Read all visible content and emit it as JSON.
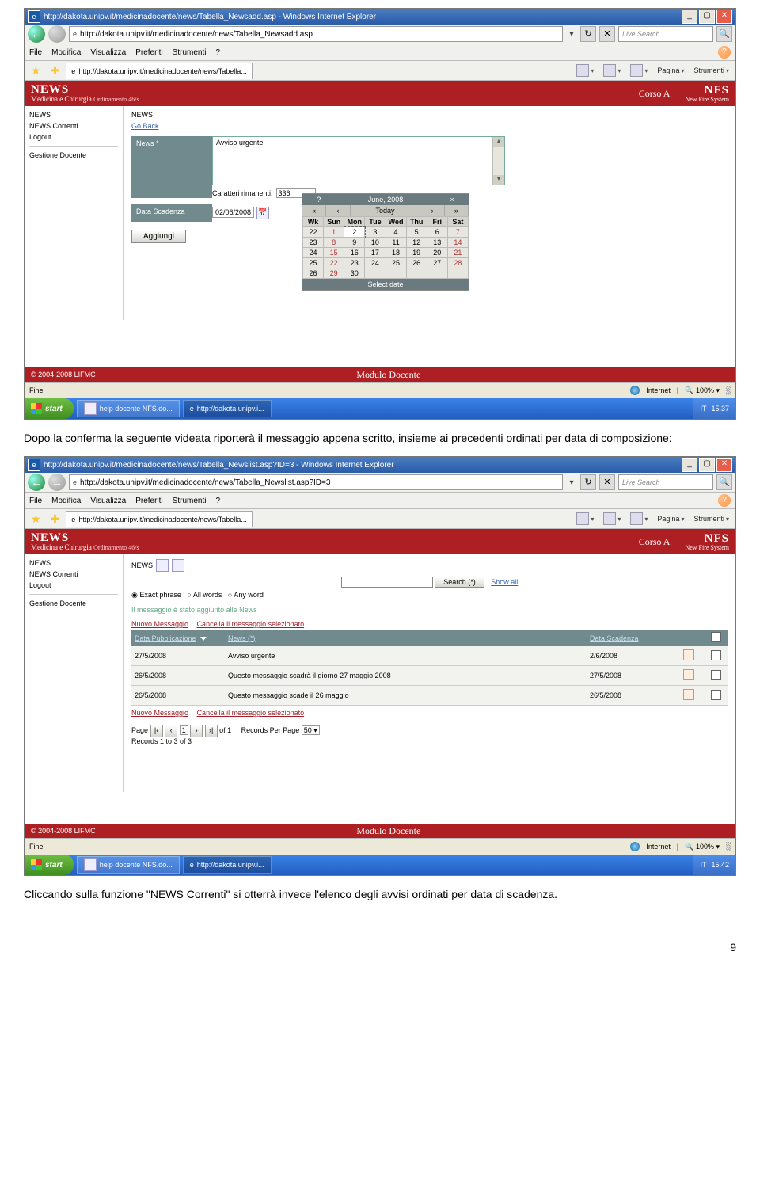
{
  "para1": "Dopo la conferma la seguente videata riporterà il messaggio appena scritto, insieme ai precedenti ordinati per data di composizione:",
  "para2": "Cliccando sulla funzione \"NEWS Correnti\" si otterrà invece l'elenco degli avvisi ordinati per data di scadenza.",
  "page_num": "9",
  "shot1": {
    "title": "http://dakota.unipv.it/medicinadocente/news/Tabella_Newsadd.asp - Windows Internet Explorer",
    "addr": "http://dakota.unipv.it/medicinadocente/news/Tabella_Newsadd.asp",
    "search_ph": "Live Search",
    "menu": [
      "File",
      "Modifica",
      "Visualizza",
      "Preferiti",
      "Strumenti",
      "?"
    ],
    "tab": "http://dakota.unipv.it/medicinadocente/news/Tabella...",
    "tools": {
      "pagina": "Pagina",
      "strumenti": "Strumenti"
    },
    "sidebar": {
      "news": "NEWS",
      "newscorr": "NEWS Correnti",
      "logout": "Logout",
      "gest": "Gestione Docente"
    },
    "hdr": {
      "news": "NEWS",
      "sub": "Medicina e Chirurgia",
      "ord": "Ordinamento 46/s",
      "corso": "Corso A",
      "nfs": "NFS",
      "nfs_sub": "New Fire System"
    },
    "content": {
      "lbl_news": "NEWS",
      "goback": "Go Back",
      "lbl_news2": "News",
      "txt": "Avviso urgente",
      "remain_lbl": "Caratteri rimanenti:",
      "remain_val": "336",
      "lbl_date": "Data Scadenza",
      "date_val": "02/06/2008",
      "btn": "Aggiungi"
    },
    "cal": {
      "month": "June, 2008",
      "today": "Today",
      "hdr2_l": "«",
      "hdr2_l2": "‹",
      "hdr2_r2": "›",
      "hdr2_r": "»",
      "wk": "Wk",
      "days": [
        "Sun",
        "Mon",
        "Tue",
        "Wed",
        "Thu",
        "Fri",
        "Sat"
      ],
      "rows": [
        {
          "wk": "22",
          "d": [
            "1",
            "2",
            "3",
            "4",
            "5",
            "6",
            "7"
          ]
        },
        {
          "wk": "23",
          "d": [
            "8",
            "9",
            "10",
            "11",
            "12",
            "13",
            "14"
          ]
        },
        {
          "wk": "24",
          "d": [
            "15",
            "16",
            "17",
            "18",
            "19",
            "20",
            "21"
          ]
        },
        {
          "wk": "25",
          "d": [
            "22",
            "23",
            "24",
            "25",
            "26",
            "27",
            "28"
          ]
        },
        {
          "wk": "26",
          "d": [
            "29",
            "30",
            "",
            "",
            "",
            "",
            ""
          ]
        }
      ],
      "foot": "Select date"
    },
    "footer": {
      "copy": "© 2004-2008 LIFMC",
      "modulo": "Modulo Docente"
    },
    "status": {
      "fine": "Fine",
      "internet": "Internet",
      "zoom": "100%"
    },
    "taskbar": {
      "start": "start",
      "t1": "help docente NFS.do...",
      "t2": "http://dakota.unipv.i...",
      "clock": "15.37",
      "it": "IT"
    }
  },
  "shot2": {
    "title": "http://dakota.unipv.it/medicinadocente/news/Tabella_Newslist.asp?ID=3 - Windows Internet Explorer",
    "addr": "http://dakota.unipv.it/medicinadocente/news/Tabella_Newslist.asp?ID=3",
    "search_ph": "Live Search",
    "menu": [
      "File",
      "Modifica",
      "Visualizza",
      "Preferiti",
      "Strumenti",
      "?"
    ],
    "tab": "http://dakota.unipv.it/medicinadocente/news/Tabella...",
    "tools": {
      "pagina": "Pagina",
      "strumenti": "Strumenti"
    },
    "sidebar": {
      "news": "NEWS",
      "newscorr": "NEWS Correnti",
      "logout": "Logout",
      "gest": "Gestione Docente"
    },
    "hdr": {
      "news": "NEWS",
      "sub": "Medicina e Chirurgia",
      "ord": "Ordinamento 46/s",
      "corso": "Corso A",
      "nfs": "NFS",
      "nfs_sub": "New Fire System"
    },
    "content": {
      "lbl_news": "NEWS",
      "sbtn": "Search (*)",
      "showall": "Show all",
      "r1": "Exact phrase",
      "r2": "All words",
      "r3": "Any word",
      "added": "Il messaggio è stato aggiunto alle News",
      "link_new": "Nuovo Messaggio",
      "link_del": "Cancella il messaggio selezionato",
      "th1": "Data Pubblicazione",
      "th2": "News (*)",
      "th3": "Data Scadenza",
      "rows": [
        {
          "d": "27/5/2008",
          "n": "Avviso urgente",
          "s": "2/6/2008"
        },
        {
          "d": "26/5/2008",
          "n": "Questo messaggio scadrà il giorno 27 maggio 2008",
          "s": "27/5/2008"
        },
        {
          "d": "26/5/2008",
          "n": "Questo messaggio scade il 26 maggio",
          "s": "26/5/2008"
        }
      ],
      "pager": {
        "page": "Page",
        "of": "of 1",
        "rpp": "Records Per Page",
        "rpp_v": "50",
        "rec": "Records 1 to 3 of 3",
        "page_v": "1"
      }
    },
    "footer": {
      "copy": "© 2004-2008 LIFMC",
      "modulo": "Modulo Docente"
    },
    "status": {
      "fine": "Fine",
      "internet": "Internet",
      "zoom": "100%"
    },
    "taskbar": {
      "start": "start",
      "t1": "help docente NFS.do...",
      "t2": "http://dakota.unipv.i...",
      "clock": "15.42",
      "it": "IT"
    }
  }
}
